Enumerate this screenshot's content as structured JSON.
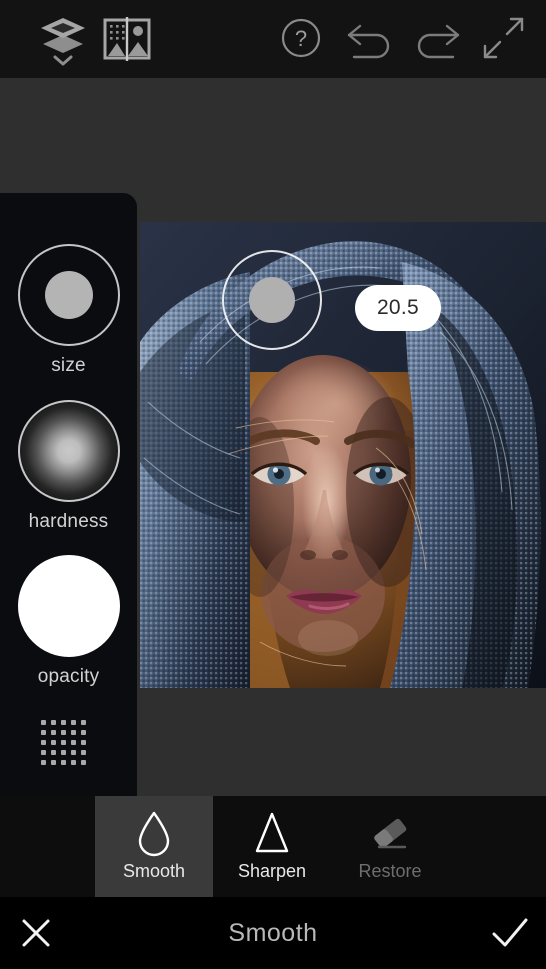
{
  "app": {
    "screen_title": "Smooth",
    "background_color": "#2f2f2f",
    "topbar_color": "#131313"
  },
  "topbar": {
    "layers_label": "layers-stack",
    "compare_label": "before-after-compare",
    "help_label": "help",
    "undo_label": "undo",
    "redo_label": "redo",
    "expand_label": "expand"
  },
  "brush_panel": {
    "controls": [
      {
        "id": "size",
        "label": "size",
        "icon": "solid-dot-in-ring"
      },
      {
        "id": "hardness",
        "label": "hardness",
        "icon": "soft-gradient-dot-in-ring"
      },
      {
        "id": "opacity",
        "label": "opacity",
        "icon": "solid-white-dot"
      }
    ],
    "handle_label": "drag-handle-dot-grid"
  },
  "brush_preview": {
    "value": "20.5",
    "ring_label": "brush-size-preview"
  },
  "tools": [
    {
      "id": "smooth",
      "label": "Smooth",
      "icon": "droplet-icon",
      "active": true,
      "enabled": true
    },
    {
      "id": "sharpen",
      "label": "Sharpen",
      "icon": "triangle-icon",
      "active": false,
      "enabled": true
    },
    {
      "id": "restore",
      "label": "Restore",
      "icon": "eraser-icon",
      "active": false,
      "enabled": false
    }
  ],
  "action_bar": {
    "cancel_label": "close-icon",
    "title": "Smooth",
    "confirm_label": "check-icon"
  },
  "colors": {
    "accent_white": "#ffffff",
    "panel_bg": "#090a0d",
    "active_tab": "#3a3a3a",
    "disabled_text": "#6e6e6e"
  }
}
